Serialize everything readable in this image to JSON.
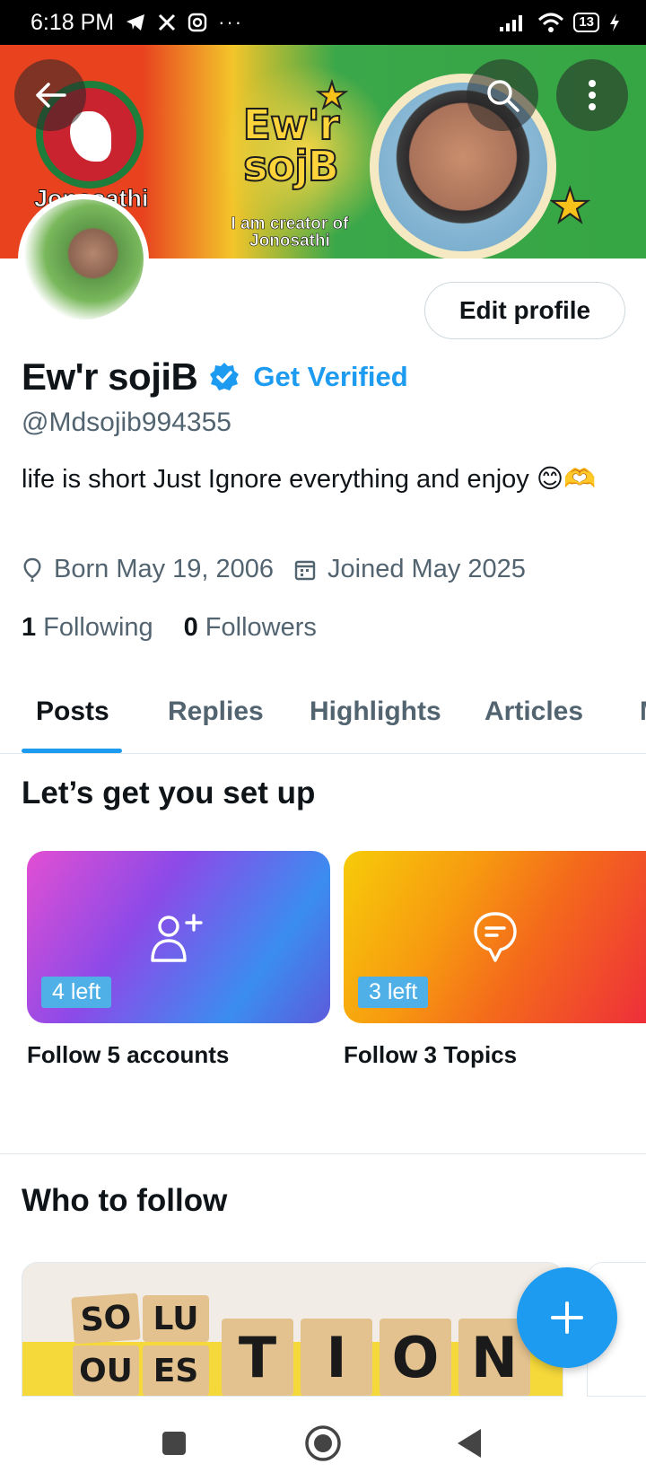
{
  "status_bar": {
    "time": "6:18 PM",
    "battery": "13",
    "icons": [
      "telegram-icon",
      "x-icon",
      "instagram-icon",
      "more-dots-icon",
      "signal-icon",
      "wifi-icon",
      "battery-icon",
      "charging-icon"
    ]
  },
  "banner": {
    "title": "Ew'r sojB",
    "title_line1": "Ew'r",
    "title_line2": "sojB",
    "subtitle_line1": "I am creator of",
    "subtitle_line2": "Jonosathi",
    "left_text": "Jonosathi"
  },
  "profile": {
    "name": "Ew'r sojiB",
    "get_verified": "Get Verified",
    "handle": "@Mdsojib994355",
    "bio": "life is short Just  Ignore everything and enjoy 😊🫶",
    "born": "Born May 19, 2006",
    "joined": "Joined May 2025",
    "following_count": "1",
    "following_label": "Following",
    "followers_count": "0",
    "followers_label": "Followers",
    "edit_profile": "Edit profile"
  },
  "tabs": [
    {
      "label": "Posts",
      "active": true
    },
    {
      "label": "Replies",
      "active": false
    },
    {
      "label": "Highlights",
      "active": false
    },
    {
      "label": "Articles",
      "active": false
    },
    {
      "label": "M",
      "active": false
    }
  ],
  "setup": {
    "title": "Let’s get you set up",
    "cards": [
      {
        "badge": "4 left",
        "label": "Follow 5 accounts",
        "icon": "add-person-icon"
      },
      {
        "badge": "3 left",
        "label": "Follow 3 Topics",
        "icon": "topic-bubble-icon"
      }
    ]
  },
  "who_to_follow": {
    "title": "Who to follow",
    "card_image_text": [
      "SO",
      "LU",
      "OU",
      "ES",
      "T",
      "I",
      "O",
      "N"
    ]
  },
  "colors": {
    "accent": "#1d9bf0",
    "text_primary": "#0f1419",
    "text_secondary": "#536471"
  }
}
